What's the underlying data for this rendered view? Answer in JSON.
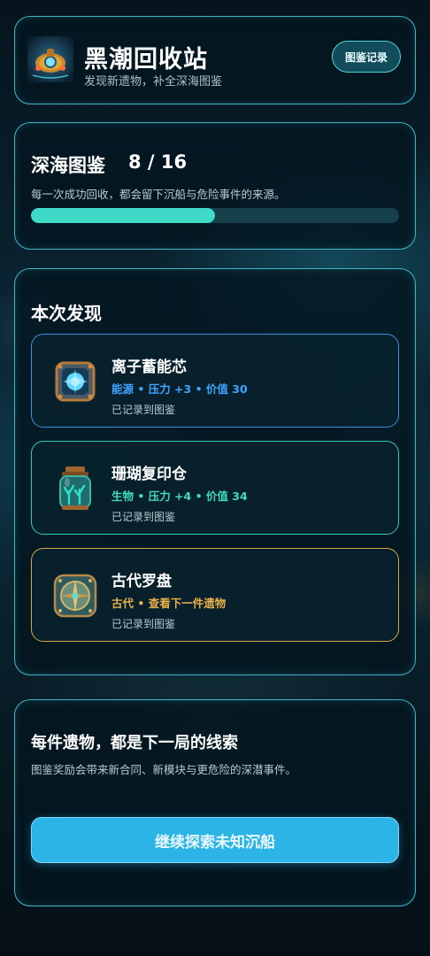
{
  "header": {
    "title": "黑潮回收站",
    "subtitle": "发现新遗物，补全深海图鉴",
    "log_button": "图鉴记录"
  },
  "codex": {
    "title": "深海图鉴",
    "count": "8 / 16",
    "progress": 0.5,
    "description": "每一次成功回收，都会留下沉船与危险事件的来源。"
  },
  "finds": {
    "title": "本次发现",
    "items": [
      {
        "name": "离子蓄能芯",
        "meta": "能源 • 压力 +3 • 价值 30",
        "note": "已记录到图鉴",
        "icon": "ion-core-icon",
        "accent": "#3d8fe0"
      },
      {
        "name": "珊瑚复印仓",
        "meta": "生物 • 压力 +4 • 价值 34",
        "note": "已记录到图鉴",
        "icon": "coral-jar-icon",
        "accent": "#35c9b8"
      },
      {
        "name": "古代罗盘",
        "meta": "古代 • 查看下一件遗物",
        "note": "已记录到图鉴",
        "icon": "compass-icon",
        "accent": "#d9a54a"
      }
    ]
  },
  "footer": {
    "title": "每件遗物，都是下一局的线索",
    "description": "图鉴奖励会带来新合同、新模块与更危险的深潜事件。",
    "cta": "继续探索未知沉船"
  }
}
